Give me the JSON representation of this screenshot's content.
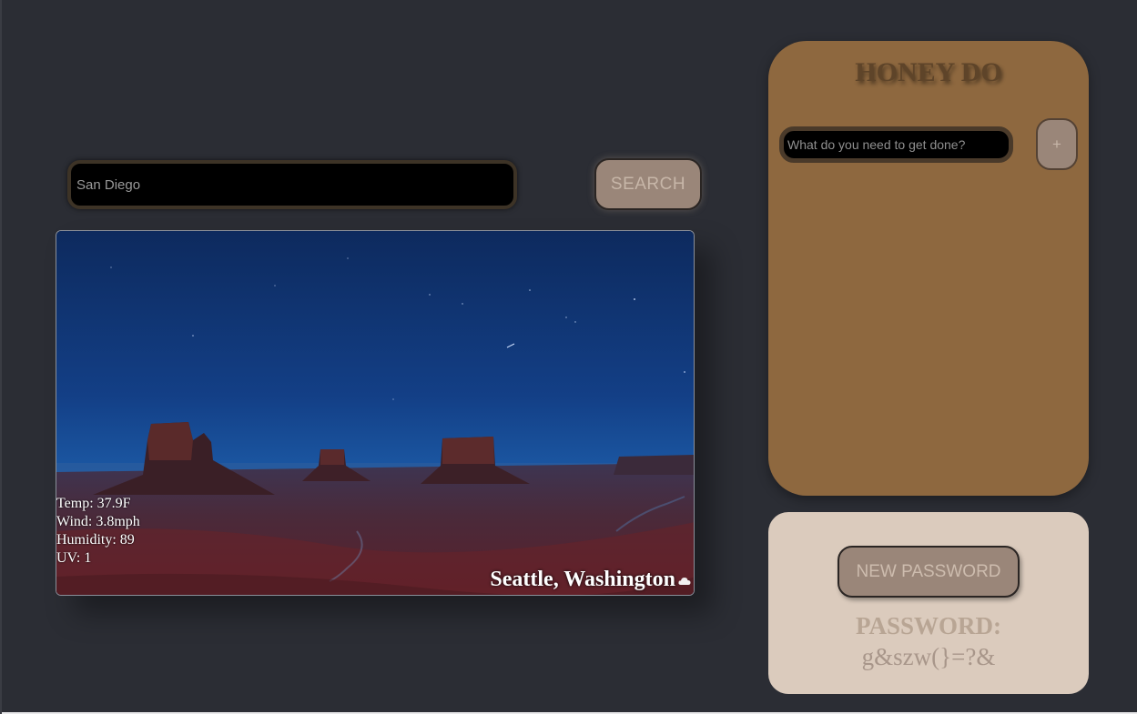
{
  "weather": {
    "search": {
      "value": "San Diego",
      "button_label": "SEARCH"
    },
    "stats": {
      "temp": "Temp: 37.9F",
      "wind": "Wind: 3.8mph",
      "humidity": "Humidity: 89",
      "uv": "UV: 1"
    },
    "location": "Seattle, Washington",
    "condition_icon": "cloud-icon"
  },
  "honey_do": {
    "title": "HONEY DO",
    "input_placeholder": "What do you need to get done?",
    "add_label": "+"
  },
  "password": {
    "button_label": "NEW PASSWORD",
    "label": "PASSWORD:",
    "value": "g&szw(}=?&"
  },
  "colors": {
    "background": "#2b2d34",
    "honey_panel": "#8e683f",
    "password_panel": "#dbcbbd",
    "button": "#9a8679"
  }
}
